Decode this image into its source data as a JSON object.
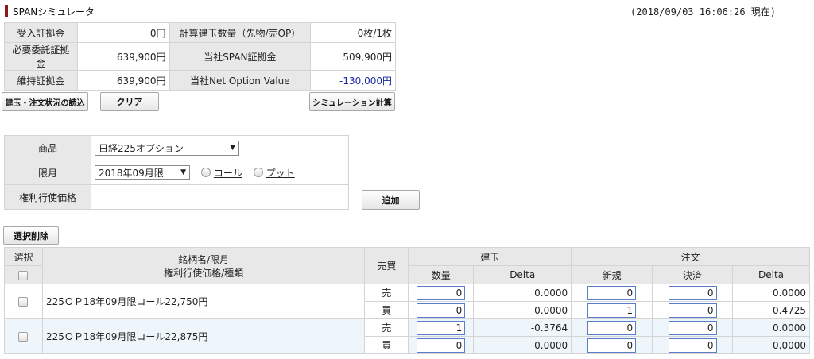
{
  "header": {
    "title": "SPANシミュレータ",
    "timestamp": "(2018/09/03 16:06:26 現在)"
  },
  "summary": {
    "received_margin_label": "受入証拠金",
    "received_margin_value": "0円",
    "calc_position_label": "計算建玉数量（先物/売OP）",
    "calc_position_value": "0枚/1枚",
    "required_margin_label": "必要委託証拠金",
    "required_margin_value": "639,900円",
    "span_margin_label": "当社SPAN証拠金",
    "span_margin_value": "509,900円",
    "maintenance_margin_label": "維持証拠金",
    "maintenance_margin_value": "639,900円",
    "net_option_label": "当社Net Option Value",
    "net_option_value": "-130,000円"
  },
  "buttons": {
    "load_positions": "建玉・注文状況の読込",
    "clear": "クリア",
    "simulate": "シミュレーション計算",
    "add": "追加",
    "delete_selected": "選択削除"
  },
  "form": {
    "product_label": "商品",
    "product_value": "日経225オプション",
    "month_label": "限月",
    "month_value": "2018年09月限",
    "call_label": "コール",
    "put_label": "プット",
    "strike_label": "権利行使価格"
  },
  "positions": {
    "headers": {
      "select": "選択",
      "name_line1": "銘柄名/限月",
      "name_line2": "権利行使価格/種類",
      "side": "売買",
      "position_group": "建玉",
      "order_group": "注文",
      "qty": "数量",
      "delta": "Delta",
      "new": "新規",
      "settle": "決済",
      "order_delta": "Delta"
    },
    "rows": [
      {
        "name": "225ＯＰ18年09月限コール22,750円",
        "sell": {
          "side": "売",
          "qty": "0",
          "delta": "0.0000",
          "new": "0",
          "settle": "0",
          "order_delta": "0.0000"
        },
        "buy": {
          "side": "買",
          "qty": "0",
          "delta": "0.0000",
          "new": "1",
          "settle": "0",
          "order_delta": "0.4725"
        }
      },
      {
        "name": "225ＯＰ18年09月限コール22,875円",
        "sell": {
          "side": "売",
          "qty": "1",
          "delta": "-0.3764",
          "new": "0",
          "settle": "0",
          "order_delta": "0.0000"
        },
        "buy": {
          "side": "買",
          "qty": "0",
          "delta": "0.0000",
          "new": "0",
          "settle": "0",
          "order_delta": "0.0000"
        }
      }
    ]
  },
  "icons": {
    "dropdown_arrow": "caret-down-icon",
    "checkbox": "checkbox-icon",
    "radio": "radio-icon"
  },
  "colors": {
    "accent_bar": "#8b1a1a",
    "negative_value": "#1a2aa0",
    "input_border": "#5a7fc7"
  }
}
